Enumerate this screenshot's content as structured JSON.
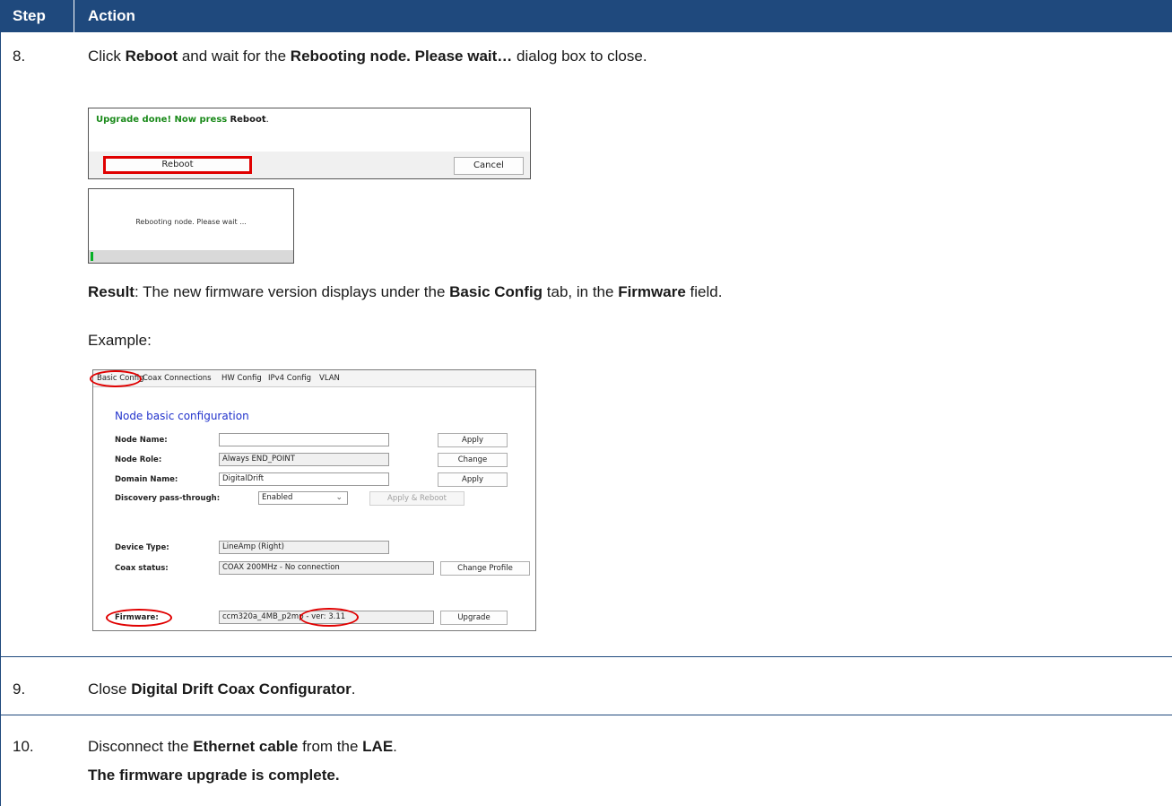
{
  "header": {
    "step": "Step",
    "action": "Action"
  },
  "step8": {
    "num": "8.",
    "t1": "Click ",
    "b1": "Reboot",
    "t2": " and wait for the ",
    "b2": "Rebooting node. Please wait…",
    "t3": " dialog box to close.",
    "dialog_upgrade": {
      "message_green": "Upgrade done! Now press",
      "message_bold": "Reboot",
      "message_end": ".",
      "reboot_label": "Reboot",
      "cancel_label": "Cancel"
    },
    "dialog_rebooting": {
      "message": "Rebooting node. Please wait ...",
      "progress": 0.01
    },
    "result_label": "Result",
    "result_t1": ": The new firmware version displays under the ",
    "result_b1": "Basic Config",
    "result_t2": " tab, in the ",
    "result_b2": "Firmware",
    "result_t3": " field.",
    "example": "Example:",
    "config": {
      "tabs": [
        "Basic Config",
        "Coax Connections",
        "HW Config",
        "IPv4 Config",
        "VLAN"
      ],
      "title": "Node basic configuration",
      "node_name_label": "Node Name:",
      "node_name_value": "",
      "apply1": "Apply",
      "node_role_label": "Node Role:",
      "node_role_value": "Always END_POINT",
      "change": "Change",
      "domain_label": "Domain Name:",
      "domain_value": "DigitalDrift",
      "apply2": "Apply",
      "discovery_label": "Discovery pass-through:",
      "discovery_value": "Enabled",
      "apply_reboot": "Apply & Reboot",
      "device_type_label": "Device Type:",
      "device_type_value": "LineAmp (Right)",
      "coax_status_label": "Coax status:",
      "coax_status_value": "COAX 200MHz - No connection",
      "change_profile": "Change Profile",
      "firmware_label": "Firmware:",
      "firmware_value": "ccm320a_4MB_p2mp - ver: 3.11",
      "upgrade": "Upgrade"
    }
  },
  "step9": {
    "num": "9.",
    "t1": "Close ",
    "b1": "Digital Drift Coax Configurator",
    "t2": "."
  },
  "step10": {
    "num": "10.",
    "t1": "Disconnect the ",
    "b1": "Ethernet cable",
    "t2": " from the ",
    "b2": "LAE",
    "t3": ".",
    "complete": "The firmware upgrade is complete."
  },
  "colors": {
    "header_bg": "#1f497d",
    "highlight": "#e00000",
    "link_blue": "#2233cc",
    "success_green": "#1a8a1a"
  }
}
